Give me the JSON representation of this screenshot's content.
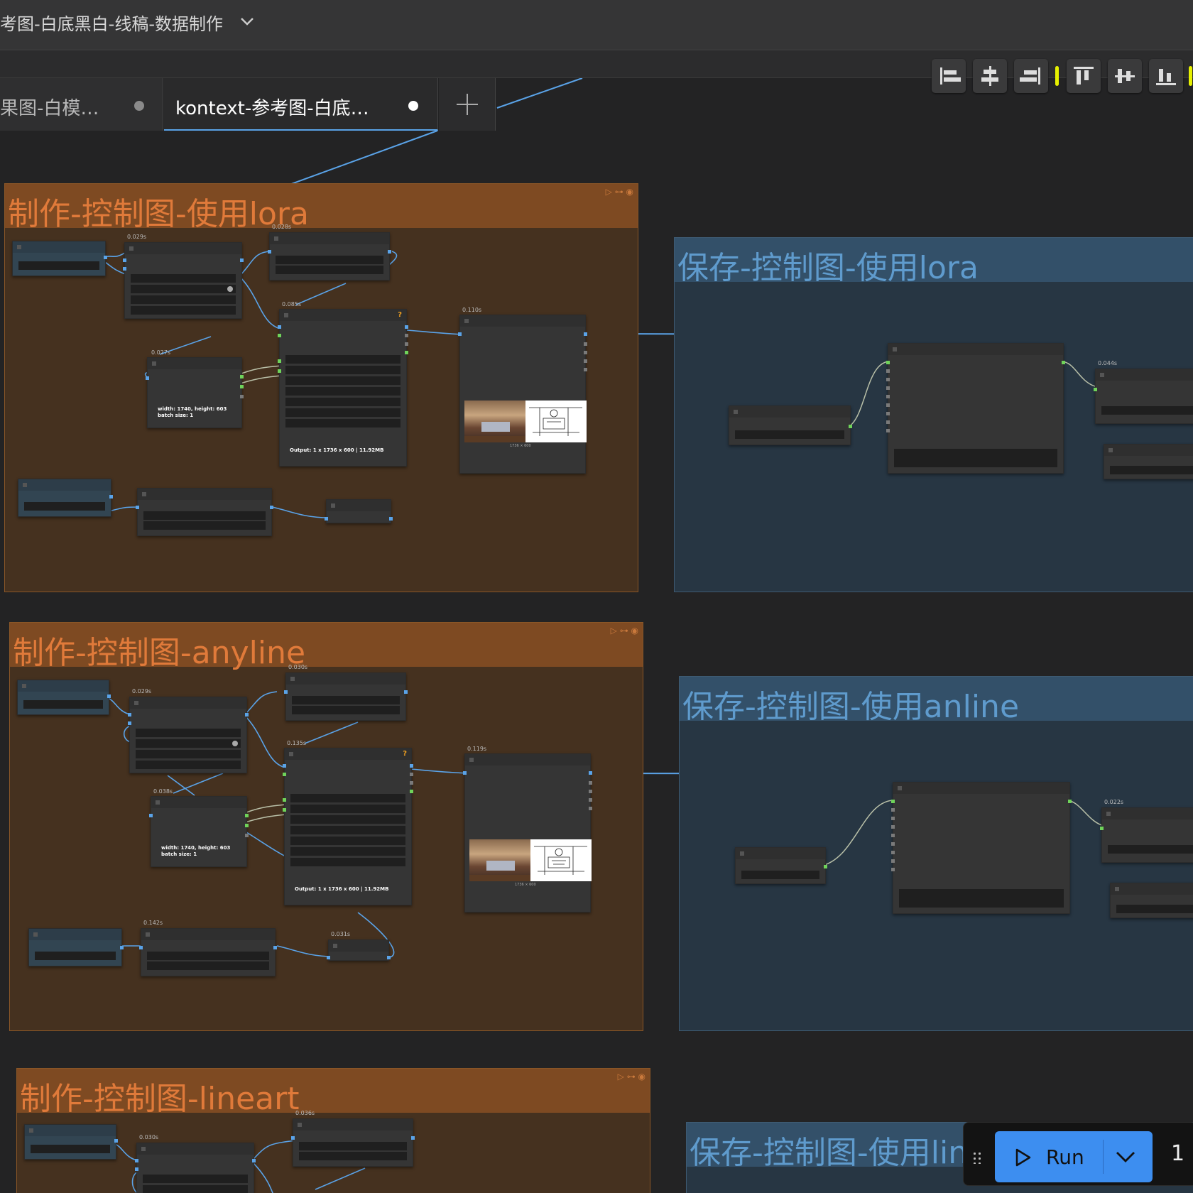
{
  "workflow": {
    "title": "考图-白底黑白-线稿-数据制作"
  },
  "tabs": [
    {
      "label": "果图-白模…"
    },
    {
      "label": "kontext-参考图-白底…"
    }
  ],
  "groups": {
    "g1": {
      "title": "制作-控制图-使用lora"
    },
    "g2": {
      "title": "保存-控制图-使用lora"
    },
    "g3": {
      "title": "制作-控制图-anyline"
    },
    "g4": {
      "title": "保存-控制图-使用anline"
    },
    "g5": {
      "title": "制作-控制图-lineart"
    },
    "g6": {
      "title": "保存-控制图-使用lin"
    }
  },
  "node_timings": {
    "g1": [
      "0.029s",
      "0.028s",
      "0.085s",
      "0.027s",
      "0.110s"
    ],
    "g2": [
      "0.044s"
    ],
    "g3": [
      "0.029s",
      "0.030s",
      "0.135s",
      "0.038s",
      "0.119s",
      "0.142s",
      "0.031s"
    ],
    "g4": [
      "0.022s"
    ],
    "g5": [
      "0.030s",
      "0.036s"
    ]
  },
  "node_texts": {
    "latent": "width: 1740, height: 603\nbatch size: 1",
    "output": "Output: 1 x 1736 x 600 | 11.92MB",
    "preview_size": "1736 × 600"
  },
  "runbar": {
    "run_label": "Run",
    "count": "1"
  },
  "colors": {
    "accent": "#3d8ef0",
    "group_orange": "#7e4a22",
    "group_blue": "#335069",
    "wire": "#5aa3e8"
  }
}
